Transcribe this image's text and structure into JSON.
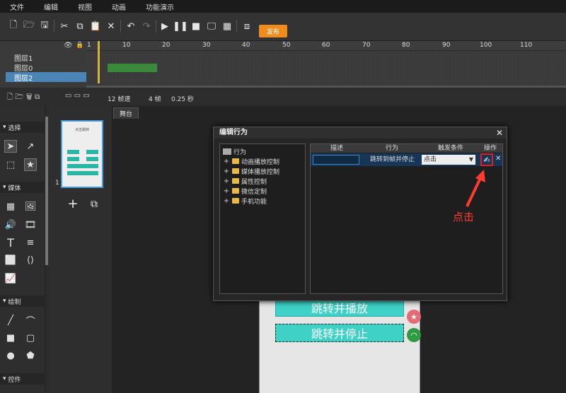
{
  "menu": [
    "文件",
    "编辑",
    "视图",
    "动画",
    "功能演示"
  ],
  "toolbar": {
    "publish_label": "发布"
  },
  "timeline": {
    "ruler_ticks": [
      "1",
      "10",
      "20",
      "30",
      "40",
      "50",
      "60",
      "70",
      "80",
      "90",
      "100",
      "110"
    ],
    "layers": [
      {
        "name": "图层1",
        "selected": false
      },
      {
        "name": "图层0",
        "selected": false
      },
      {
        "name": "图层2",
        "selected": true
      }
    ],
    "fps_label": "12 帧速",
    "frame_count": "4 帧",
    "duration": "0.25 秒"
  },
  "left_panel": {
    "sections": [
      "选择",
      "媒体",
      "绘制",
      "控件"
    ]
  },
  "pages": {
    "page_number": "1",
    "thumb_title": "点击跳转"
  },
  "stage": {
    "tab_label": "舞台",
    "buttons": [
      "跳转并播放",
      "跳转并停止"
    ]
  },
  "dialog": {
    "title": "编辑行为",
    "tree_root": "行为",
    "tree_items": [
      "动画播放控制",
      "媒体播放控制",
      "属性控制",
      "微信定制",
      "手机功能"
    ],
    "columns": [
      "描述",
      "行为",
      "触发条件",
      "操作"
    ],
    "row": {
      "description": "",
      "action": "跳转到帧并停止",
      "trigger": "点击"
    }
  },
  "annotation": {
    "text": "点击",
    "color": "#ff3b30"
  }
}
